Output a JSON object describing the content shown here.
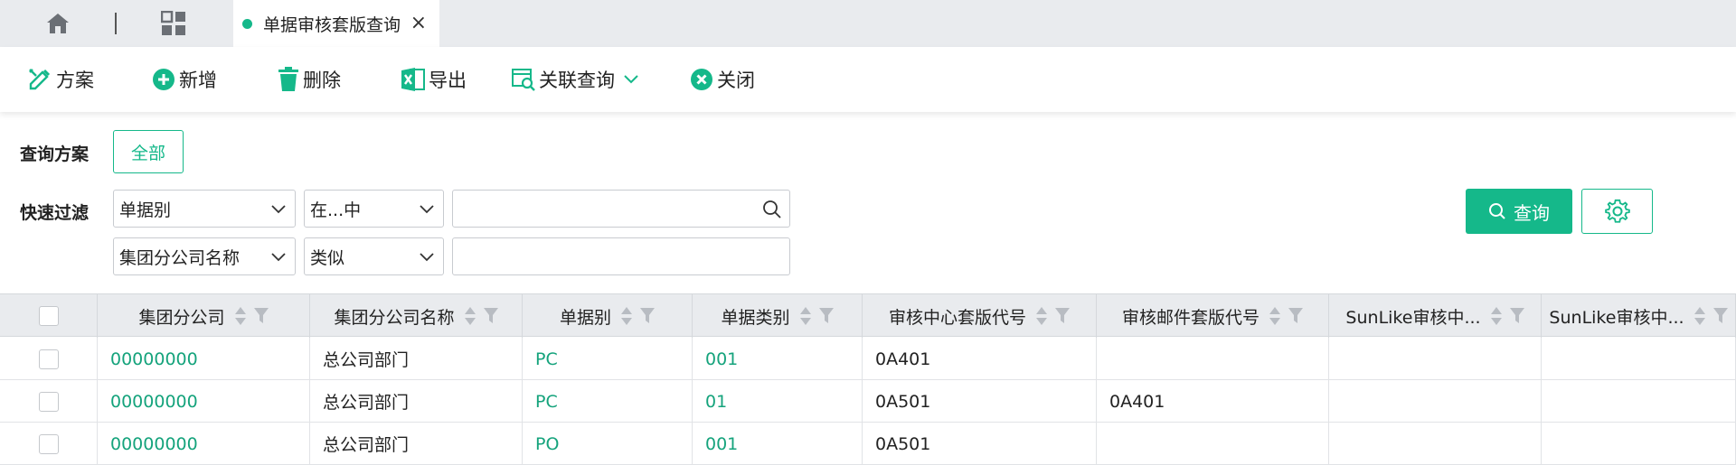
{
  "tabbar": {
    "active_tab": "单据审核套版查询",
    "close_glyph": "×"
  },
  "toolbar": {
    "items": [
      {
        "label": "方案",
        "icon": "scheme-icon"
      },
      {
        "label": "新增",
        "icon": "add-icon"
      },
      {
        "label": "删除",
        "icon": "trash-icon"
      },
      {
        "label": "导出",
        "icon": "excel-icon"
      },
      {
        "label": "关联查询",
        "icon": "link-query-icon"
      },
      {
        "label": "关闭",
        "icon": "close-circle-icon"
      }
    ]
  },
  "filters": {
    "scheme_label": "查询方案",
    "scheme_all": "全部",
    "quick_label": "快速过滤",
    "row1": {
      "field": "单据别",
      "op": "在...中",
      "value": ""
    },
    "row2": {
      "field": "集团分公司名称",
      "op": "类似",
      "value": ""
    },
    "query_button": "查询"
  },
  "table": {
    "columns": [
      "集团分公司",
      "集团分公司名称",
      "单据别",
      "单据类别",
      "审核中心套版代号",
      "审核邮件套版代号",
      "SunLike审核中...",
      "SunLike审核中..."
    ],
    "rows": [
      [
        "00000000",
        "总公司部门",
        "PC",
        "001",
        "0A401",
        "",
        "",
        ""
      ],
      [
        "00000000",
        "总公司部门",
        "PC",
        "01",
        "0A501",
        "0A401",
        "",
        ""
      ],
      [
        "00000000",
        "总公司部门",
        "PO",
        "001",
        "0A501",
        "",
        "",
        ""
      ]
    ]
  },
  "colors": {
    "accent": "#15b88a",
    "link": "#15a37c",
    "header_bg": "#e9ebee"
  }
}
